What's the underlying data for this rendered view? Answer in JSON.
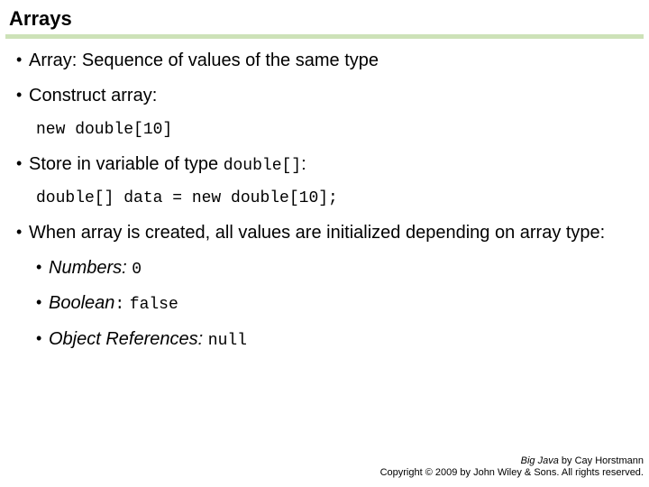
{
  "title": "Arrays",
  "bullets": {
    "b1": "Array: Sequence of values of the same type",
    "b2": "Construct array:",
    "code1": "new double[10]",
    "b3a": "Store in variable of type ",
    "b3code": "double[]",
    "b3colon": ":",
    "code2": "double[] data = new double[10];",
    "b4": "When array is created, all values are initialized depending on array type:",
    "sub": {
      "numbers_label": "Numbers:",
      "numbers_val": "0",
      "boolean_label": "Boolean",
      "boolean_colon": ":",
      "boolean_val": "false",
      "objref_label": "Object References:",
      "objref_val": "null"
    }
  },
  "footer": {
    "book": "Big Java",
    "by": " by Cay Horstmann",
    "copyright": "Copyright © 2009 by John Wiley & Sons. All rights reserved."
  }
}
